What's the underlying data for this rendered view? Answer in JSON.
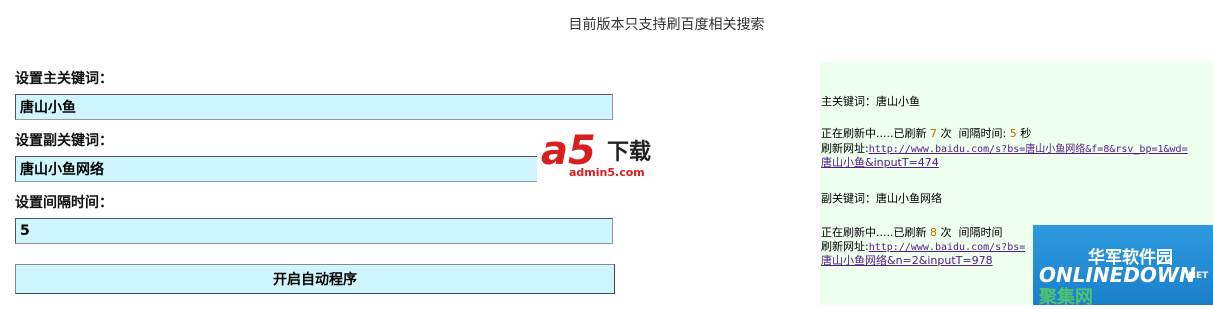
{
  "notice": "目前版本只支持刷百度相关搜索",
  "form": {
    "main_keyword_label": "设置主关键词：",
    "main_keyword_value": "唐山小鱼",
    "sub_keyword_label": "设置副关键词：",
    "sub_keyword_value": "唐山小鱼网络",
    "interval_label": "设置间隔时间：",
    "interval_value": "5",
    "start_button": "开启自动程序"
  },
  "status_panel": {
    "main": {
      "keyword_label": "主关键词：",
      "keyword": "唐山小鱼",
      "refreshing": "正在刷新中.....已刷新",
      "count": "7",
      "count_unit": "次",
      "interval_label": "间隔时间:",
      "interval": "5",
      "interval_unit": "秒",
      "url_label": "刷新网址:",
      "url_part1": "http://www.baidu.com/s?bs=唐山小鱼网络&f=8&rsv_bp=1&wd=",
      "url_part2": "唐山小鱼&inputT=474"
    },
    "sub": {
      "keyword_label": "副关键词：",
      "keyword": "唐山小鱼网络",
      "refreshing": "正在刷新中.....已刷新",
      "count": "8",
      "count_unit": "次",
      "interval_label": "间隔时间",
      "url_label": "刷新网址:",
      "url_part1": "http://www.baidu.com/s?bs=",
      "url_part2": "唐山小鱼网络&n=2&inputT=978"
    }
  },
  "watermarks": {
    "a5_logo": "a5",
    "a5_download": "下载",
    "a5_site": "admin5.com",
    "hj_cn": "华军软件园",
    "hj_en": "ONLINEDOWN",
    "hj_net": ".NET",
    "hj_sub": "聚集网"
  }
}
